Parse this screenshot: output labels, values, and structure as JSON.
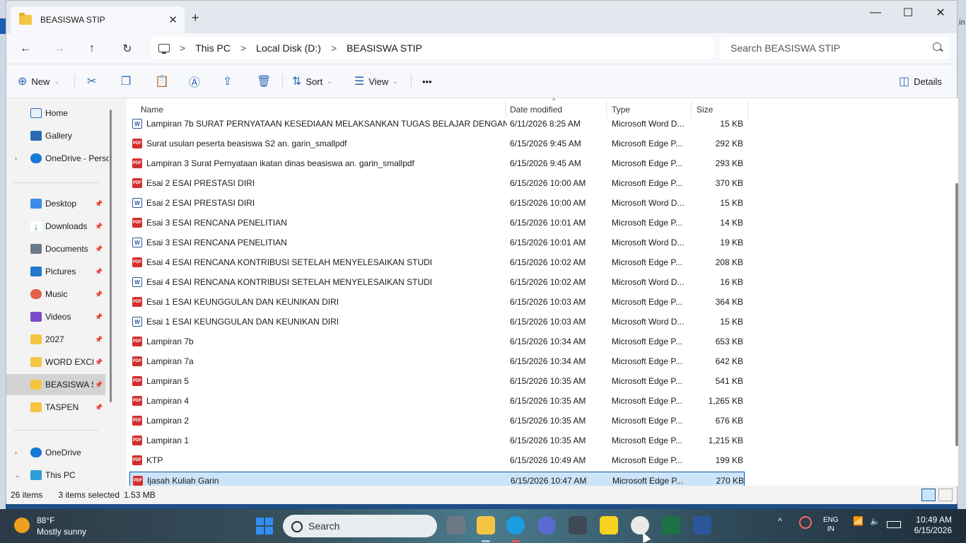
{
  "window": {
    "tab_title": "BEASISWA STIP",
    "tab_close": "✕",
    "new_tab": "+",
    "minimize": "—",
    "maximize": "☐",
    "close": "✕"
  },
  "desktop": {
    "right_text": "in"
  },
  "nav": {
    "back": "←",
    "forward": "→",
    "up": "↑",
    "refresh": "↻",
    "breadcrumb": [
      "This PC",
      "Local Disk (D:)",
      "BEASISWA STIP"
    ],
    "separator": ">",
    "search_placeholder": "Search BEASISWA STIP"
  },
  "toolbar": {
    "new_label": "New",
    "sort_label": "Sort",
    "view_label": "View",
    "more_label": "•••",
    "details_label": "Details",
    "chevron": "⌄"
  },
  "sidebar": {
    "home": "Home",
    "gallery": "Gallery",
    "onedrive_personal": "OneDrive - Perso",
    "desktop": "Desktop",
    "downloads": "Downloads",
    "documents": "Documents",
    "pictures": "Pictures",
    "music": "Music",
    "videos": "Videos",
    "folder_2027": "2027",
    "word_excel": "WORD EXCEL",
    "beasiswa": "BEASISWA STIP",
    "taspen": "TASPEN",
    "onedrive": "OneDrive",
    "this_pc": "This PC",
    "expand_collapsed": "›",
    "expand_open": "⌄",
    "pin": "📌"
  },
  "columns": {
    "name": "Name",
    "date": "Date modified",
    "type": "Type",
    "size": "Size",
    "sort_caret": "^"
  },
  "files": [
    {
      "icon": "doc",
      "name": "Lampiran 7b SURAT PERNYATAAN KESEDIAAN MELAKSANKAN TUGAS BELAJAR DENGAN",
      "date": "6/11/2026 8:25 AM",
      "type": "Microsoft Word D...",
      "size": "15 KB"
    },
    {
      "icon": "pdf",
      "name": "Surat usulan peserta beasiswa S2 an. garin_smallpdf",
      "date": "6/15/2026 9:45 AM",
      "type": "Microsoft Edge P...",
      "size": "292 KB"
    },
    {
      "icon": "pdf",
      "name": "Lampiran 3 Surat Pernyataan ikatan dinas beasiswa an. garin_smallpdf",
      "date": "6/15/2026 9:45 AM",
      "type": "Microsoft Edge P...",
      "size": "293 KB"
    },
    {
      "icon": "pdf",
      "name": "Esai 2 ESAI PRESTASI DIRI",
      "date": "6/15/2026 10:00 AM",
      "type": "Microsoft Edge P...",
      "size": "370 KB"
    },
    {
      "icon": "doc",
      "name": "Esai 2 ESAI PRESTASI DIRI",
      "date": "6/15/2026 10:00 AM",
      "type": "Microsoft Word D...",
      "size": "15 KB"
    },
    {
      "icon": "pdf",
      "name": "Esai 3 ESAI RENCANA PENELITIAN",
      "date": "6/15/2026 10:01 AM",
      "type": "Microsoft Edge P...",
      "size": "14 KB"
    },
    {
      "icon": "doc",
      "name": "Esai 3 ESAI RENCANA PENELITIAN",
      "date": "6/15/2026 10:01 AM",
      "type": "Microsoft Word D...",
      "size": "19 KB"
    },
    {
      "icon": "pdf",
      "name": "Esai 4 ESAI RENCANA KONTRIBUSI SETELAH MENYELESAIKAN STUDI",
      "date": "6/15/2026 10:02 AM",
      "type": "Microsoft Edge P...",
      "size": "208 KB"
    },
    {
      "icon": "doc",
      "name": "Esai 4 ESAI RENCANA KONTRIBUSI SETELAH MENYELESAIKAN STUDI",
      "date": "6/15/2026 10:02 AM",
      "type": "Microsoft Word D...",
      "size": "16 KB"
    },
    {
      "icon": "pdf",
      "name": "Esai 1 ESAI KEUNGGULAN DAN KEUNIKAN DIRI",
      "date": "6/15/2026 10:03 AM",
      "type": "Microsoft Edge P...",
      "size": "364 KB"
    },
    {
      "icon": "doc",
      "name": "Esai 1 ESAI KEUNGGULAN DAN KEUNIKAN DIRI",
      "date": "6/15/2026 10:03 AM",
      "type": "Microsoft Word D...",
      "size": "15 KB"
    },
    {
      "icon": "pdf",
      "name": "Lampiran 7b",
      "date": "6/15/2026 10:34 AM",
      "type": "Microsoft Edge P...",
      "size": "653 KB"
    },
    {
      "icon": "pdf",
      "name": "Lampiran 7a",
      "date": "6/15/2026 10:34 AM",
      "type": "Microsoft Edge P...",
      "size": "642 KB"
    },
    {
      "icon": "pdf",
      "name": "Lampiran 5",
      "date": "6/15/2026 10:35 AM",
      "type": "Microsoft Edge P...",
      "size": "541 KB"
    },
    {
      "icon": "pdf",
      "name": "Lampiran 4",
      "date": "6/15/2026 10:35 AM",
      "type": "Microsoft Edge P...",
      "size": "1,265 KB"
    },
    {
      "icon": "pdf",
      "name": "Lampiran 2",
      "date": "6/15/2026 10:35 AM",
      "type": "Microsoft Edge P...",
      "size": "676 KB"
    },
    {
      "icon": "pdf",
      "name": "Lampiran 1",
      "date": "6/15/2026 10:35 AM",
      "type": "Microsoft Edge P...",
      "size": "1,215 KB"
    },
    {
      "icon": "pdf",
      "name": "KTP",
      "date": "6/15/2026 10:49 AM",
      "type": "Microsoft Edge P...",
      "size": "199 KB"
    },
    {
      "icon": "pdf",
      "name": "Ijasah Kuliah Garin",
      "date": "6/15/2026 10:47 AM",
      "type": "Microsoft Edge P...",
      "size": "270 KB",
      "selected": true
    }
  ],
  "icon_labels": {
    "pdf": "PDF",
    "doc": "W"
  },
  "status": {
    "item_count": "26 items",
    "selected": "3 items selected",
    "selected_size": "1.53 MB"
  },
  "taskbar": {
    "temperature": "88°F",
    "condition": "Mostly sunny",
    "search_label": "Search",
    "lang_top": "ENG",
    "lang_bottom": "IN",
    "time": "10:49 AM",
    "date": "6/15/2026",
    "tray_chevron": "^"
  }
}
